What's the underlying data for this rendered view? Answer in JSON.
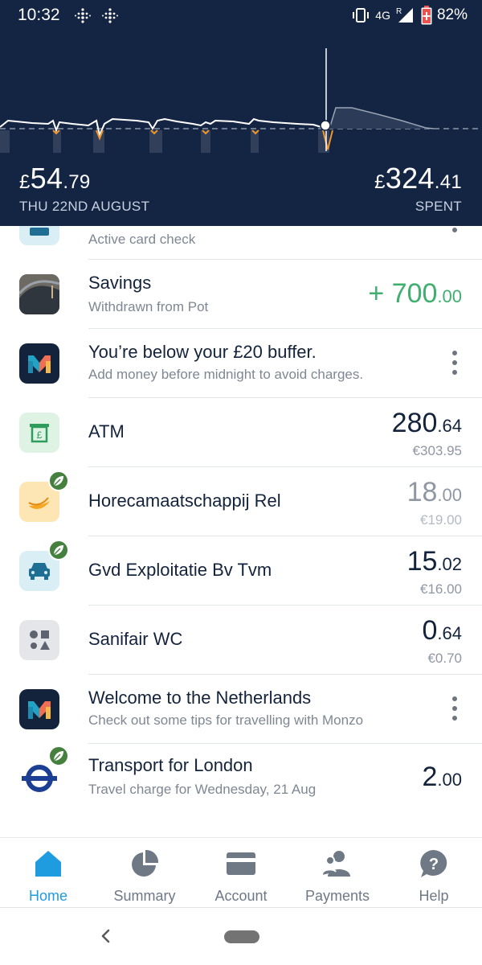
{
  "status_bar": {
    "time": "10:32",
    "network": "4G",
    "roaming": "R",
    "battery": "82%"
  },
  "header": {
    "balance": {
      "currency": "£",
      "whole": "54",
      "pence": ".79"
    },
    "balance_label": "THU 22ND AUGUST",
    "spent": {
      "currency": "£",
      "whole": "324",
      "pence": ".41"
    },
    "spent_label": "SPENT",
    "colors": {
      "background": "#142443",
      "line": "#ffffff",
      "dip": "#f0962d"
    }
  },
  "feed": {
    "partial_item": {
      "subtitle": "Active card check",
      "icon": "car-icon"
    },
    "items": [
      {
        "title": "Savings",
        "subtitle": "Withdrawn from Pot",
        "amount_prefix": "+ ",
        "amount_whole": "700",
        "amount_pence": ".00",
        "icon": "savings-pot-photo"
      },
      {
        "title": "You’re below your £20 buffer.",
        "subtitle": "Add money before midnight to avoid charges.",
        "icon": "monzo-logo"
      },
      {
        "title": "ATM",
        "amount_whole": "280",
        "amount_pence": ".64",
        "amount_sub": "€303.95",
        "icon": "atm-icon"
      },
      {
        "title": "Horecamaatschappij Rel",
        "amount_whole": "18",
        "amount_pence": ".00",
        "amount_sub": "€19.00",
        "icon": "banana-icon"
      },
      {
        "title": "Gvd Exploitatie Bv Tvm",
        "amount_whole": "15",
        "amount_pence": ".02",
        "amount_sub": "€16.00",
        "icon": "car-icon"
      },
      {
        "title": "Sanifair WC",
        "amount_whole": "0",
        "amount_pence": ".64",
        "amount_sub": "€0.70",
        "icon": "shapes-icon"
      },
      {
        "title": "Welcome to the Netherlands",
        "subtitle": "Check out some tips for travelling with Monzo",
        "icon": "monzo-logo"
      },
      {
        "title": "Transport for London",
        "subtitle": "Travel charge for Wednesday, 21 Aug",
        "amount_whole": "2",
        "amount_pence": ".00",
        "icon": "tfl-roundel-icon"
      }
    ]
  },
  "bottom_nav": {
    "items": [
      {
        "label": "Home",
        "icon": "home-icon",
        "active": true
      },
      {
        "label": "Summary",
        "icon": "pie-chart-icon"
      },
      {
        "label": "Account",
        "icon": "card-icon"
      },
      {
        "label": "Payments",
        "icon": "people-icon"
      },
      {
        "label": "Help",
        "icon": "help-bubble-icon"
      }
    ],
    "colors": {
      "active": "#1f9be0",
      "inactive": "#6f7885"
    }
  }
}
